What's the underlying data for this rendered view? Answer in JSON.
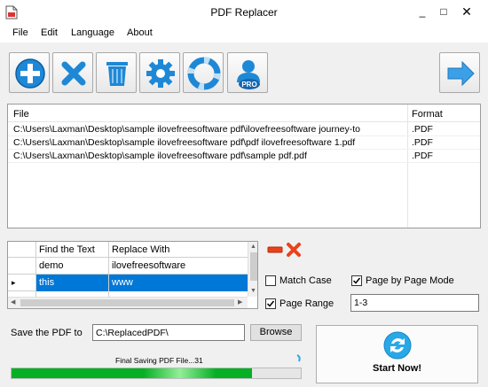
{
  "window": {
    "title": "PDF Replacer",
    "min_glyph": "_",
    "max_glyph": "□",
    "close_glyph": "✕"
  },
  "menu": {
    "items": [
      "File",
      "Edit",
      "Language",
      "About"
    ]
  },
  "toolbar": {
    "buttons": [
      "add-icon",
      "remove-icon",
      "trash-icon",
      "settings-icon",
      "help-icon",
      "pro-user-icon"
    ],
    "next_icon": "arrow-right-icon",
    "pro_badge": "PRO"
  },
  "files": {
    "headers": {
      "file": "File",
      "format": "Format"
    },
    "rows": [
      {
        "path": "C:\\Users\\Laxman\\Desktop\\sample ilovefreesoftware pdf\\ilovefreesoftware journey-to",
        "format": ".PDF"
      },
      {
        "path": "C:\\Users\\Laxman\\Desktop\\sample ilovefreesoftware pdf\\pdf ilovefreesoftware 1.pdf",
        "format": ".PDF"
      },
      {
        "path": "C:\\Users\\Laxman\\Desktop\\sample ilovefreesoftware pdf\\sample pdf.pdf",
        "format": ".PDF"
      }
    ]
  },
  "replace_table": {
    "headers": {
      "find": "Find the Text",
      "replace": "Replace With"
    },
    "rows": [
      {
        "find": "demo",
        "replace": "ilovefreesoftware",
        "selected": false
      },
      {
        "find": "this",
        "replace": "www",
        "selected": true
      }
    ],
    "row_indicator": "▸"
  },
  "options": {
    "match_case": {
      "label": "Match Case",
      "checked": false
    },
    "page_by_page": {
      "label": "Page by Page Mode",
      "checked": true
    },
    "page_range": {
      "label": "Page Range",
      "checked": true,
      "value": "1-3"
    }
  },
  "output": {
    "label": "Save the PDF to",
    "path": "C:\\ReplacedPDF\\",
    "browse_label": "Browse"
  },
  "start": {
    "label": "Start Now!"
  },
  "progress": {
    "status": "Final Saving PDF File...31",
    "value": 0.83
  },
  "colors": {
    "accent": "#0078d7",
    "progress": "#06b025",
    "delete": "#e8431c"
  }
}
